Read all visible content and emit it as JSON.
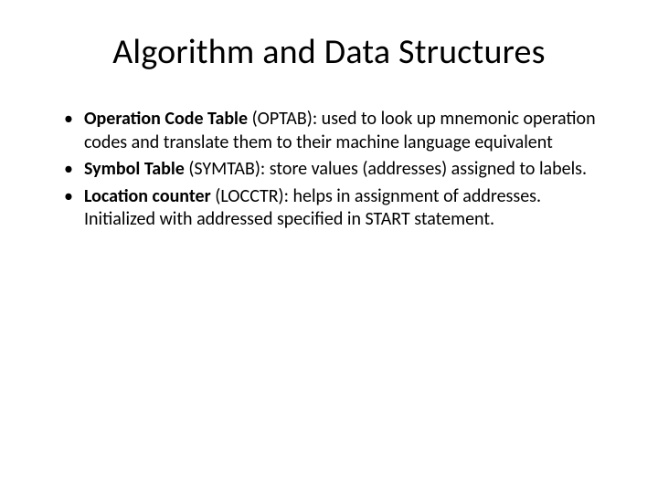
{
  "title": "Algorithm and Data Structures",
  "bullets": [
    {
      "term": "Operation Code Table ",
      "body": "(OPTAB): used to look up mnemonic operation codes and translate them to their machine language equivalent"
    },
    {
      "term": "Symbol Table ",
      "body": "(SYMTAB): store values (addresses) assigned to labels."
    },
    {
      "term": "Location counter ",
      "body": "(LOCCTR): helps in assignment of addresses. Initialized with addressed specified in START statement."
    }
  ]
}
